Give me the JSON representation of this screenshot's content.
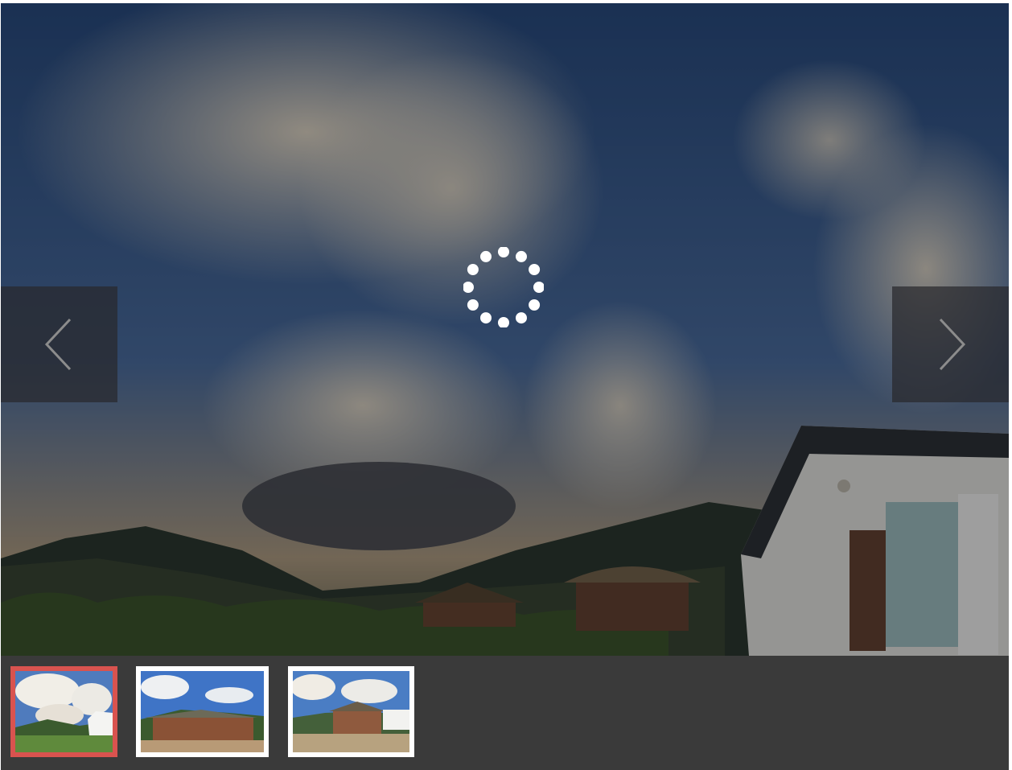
{
  "gallery": {
    "main_image": {
      "alt": "",
      "state": "loading"
    },
    "nav": {
      "prev_icon": "chevron-left-icon",
      "next_icon": "chevron-right-icon"
    },
    "spinner_icon": "loading-spinner-icon",
    "thumbnails": [
      {
        "index": 1,
        "active": true
      },
      {
        "index": 2,
        "active": false
      },
      {
        "index": 3,
        "active": false
      }
    ],
    "colors": {
      "active_border": "#d9534f",
      "thumb_border": "#ffffff",
      "strip_background": "#3a3a3a"
    }
  }
}
